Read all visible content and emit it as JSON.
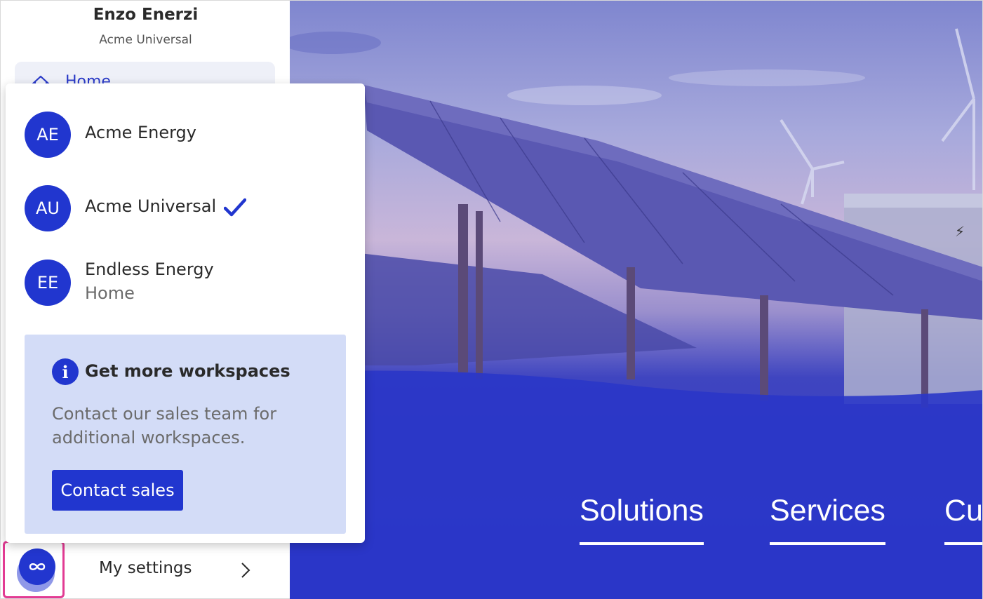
{
  "sidebar": {
    "user_name": "Enzo Enerzi",
    "user_org": "Acme Universal",
    "nav_home_label": "Home",
    "settings_label": "My settings"
  },
  "workspace_menu": {
    "items": [
      {
        "initials": "AE",
        "name": "Acme Energy",
        "sub": "",
        "selected": false
      },
      {
        "initials": "AU",
        "name": "Acme Universal",
        "sub": "",
        "selected": true
      },
      {
        "initials": "EE",
        "name": "Endless Energy",
        "sub": "Home",
        "selected": false
      }
    ],
    "info": {
      "title": "Get more workspaces",
      "text": "Contact our sales team for additional workspaces.",
      "button": "Contact sales"
    }
  },
  "hero": {
    "nav": [
      "Solutions",
      "Services",
      "Cu"
    ]
  },
  "colors": {
    "accent": "#2136cf",
    "info_bg": "#d3dcf7",
    "highlight_frame": "#e23b93"
  },
  "icons": {
    "home": "house-icon",
    "check": "check-icon",
    "info": "info-icon",
    "chevron": "chevron-right-icon",
    "app_logo": "infinity-icon"
  }
}
